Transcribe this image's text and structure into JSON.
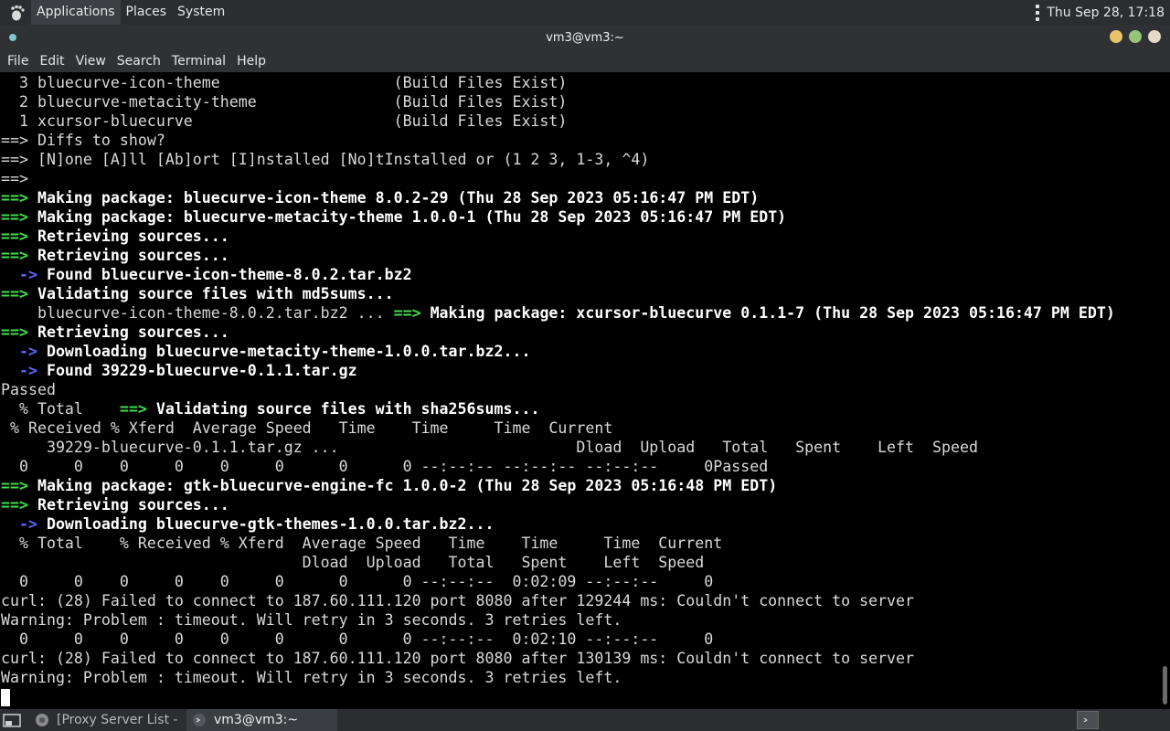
{
  "top_panel": {
    "menus": [
      "Applications",
      "Places",
      "System"
    ],
    "clock": "Thu Sep 28, 17:18"
  },
  "window": {
    "title": "vm3@vm3:~",
    "menu": [
      "File",
      "Edit",
      "View",
      "Search",
      "Terminal",
      "Help"
    ]
  },
  "terminal": {
    "lines": [
      [
        {
          "t": "  3 bluecurve-icon-theme                   (Build Files Exist)",
          "s": "n"
        }
      ],
      [
        {
          "t": "  2 bluecurve-metacity-theme               (Build Files Exist)",
          "s": "n"
        }
      ],
      [
        {
          "t": "  1 xcursor-bluecurve                      (Build Files Exist)",
          "s": "n"
        }
      ],
      [
        {
          "t": "==> Diffs to show?",
          "s": "n"
        }
      ],
      [
        {
          "t": "==> [N]one [A]ll [Ab]ort [I]nstalled [No]tInstalled or (1 2 3, 1-3, ^4)",
          "s": "n"
        }
      ],
      [
        {
          "t": "==> ",
          "s": "n"
        }
      ],
      [
        {
          "t": "==> ",
          "s": "g"
        },
        {
          "t": "Making package: bluecurve-icon-theme 8.0.2-29 (Thu 28 Sep 2023 05:16:47 PM EDT)",
          "s": "b"
        }
      ],
      [
        {
          "t": "==> ",
          "s": "g"
        },
        {
          "t": "Making package: bluecurve-metacity-theme 1.0.0-1 (Thu 28 Sep 2023 05:16:47 PM EDT)",
          "s": "b"
        }
      ],
      [
        {
          "t": "==> ",
          "s": "g"
        },
        {
          "t": "Retrieving sources...",
          "s": "b"
        }
      ],
      [
        {
          "t": "==> ",
          "s": "g"
        },
        {
          "t": "Retrieving sources...",
          "s": "b"
        }
      ],
      [
        {
          "t": "  -> ",
          "s": "u"
        },
        {
          "t": "Found bluecurve-icon-theme-8.0.2.tar.bz2",
          "s": "b"
        }
      ],
      [
        {
          "t": "==> ",
          "s": "g"
        },
        {
          "t": "Validating source files with md5sums...",
          "s": "b"
        }
      ],
      [
        {
          "t": "    bluecurve-icon-theme-8.0.2.tar.bz2 ... ",
          "s": "n"
        },
        {
          "t": "==> ",
          "s": "g"
        },
        {
          "t": "Making package: xcursor-bluecurve 0.1.1-7 (Thu 28 Sep 2023 05:16:47 PM EDT)",
          "s": "b"
        }
      ],
      [
        {
          "t": "==> ",
          "s": "g"
        },
        {
          "t": "Retrieving sources...",
          "s": "b"
        }
      ],
      [
        {
          "t": "  -> ",
          "s": "u"
        },
        {
          "t": "Downloading bluecurve-metacity-theme-1.0.0.tar.bz2...",
          "s": "b"
        }
      ],
      [
        {
          "t": "  -> ",
          "s": "u"
        },
        {
          "t": "Found 39229-bluecurve-0.1.1.tar.gz",
          "s": "b"
        }
      ],
      [
        {
          "t": "Passed",
          "s": "n"
        }
      ],
      [
        {
          "t": "  % Total    ",
          "s": "n"
        },
        {
          "t": "==> ",
          "s": "g"
        },
        {
          "t": "Validating source files with sha256sums...",
          "s": "b"
        }
      ],
      [
        {
          "t": " % Received % Xferd  Average Speed   Time    Time     Time  Current",
          "s": "n"
        }
      ],
      [
        {
          "t": "     39229-bluecurve-0.1.1.tar.gz ...                          Dload  Upload   Total   Spent    Left  Speed",
          "s": "n"
        }
      ],
      [
        {
          "t": "  0     0    0     0    0     0      0      0 --:--:-- --:--:-- --:--:--     0Passed",
          "s": "n"
        }
      ],
      [
        {
          "t": "==> ",
          "s": "g"
        },
        {
          "t": "Making package: gtk-bluecurve-engine-fc 1.0.0-2 (Thu 28 Sep 2023 05:16:48 PM EDT)",
          "s": "b"
        }
      ],
      [
        {
          "t": "==> ",
          "s": "g"
        },
        {
          "t": "Retrieving sources...",
          "s": "b"
        }
      ],
      [
        {
          "t": "  -> ",
          "s": "u"
        },
        {
          "t": "Downloading bluecurve-gtk-themes-1.0.0.tar.bz2...",
          "s": "b"
        }
      ],
      [
        {
          "t": "  % Total    % Received % Xferd  Average Speed   Time    Time     Time  Current",
          "s": "n"
        }
      ],
      [
        {
          "t": "                                 Dload  Upload   Total   Spent    Left  Speed",
          "s": "n"
        }
      ],
      [
        {
          "t": "  0     0    0     0    0     0      0      0 --:--:--  0:02:09 --:--:--     0",
          "s": "n"
        }
      ],
      [
        {
          "t": "curl: (28) Failed to connect to 187.60.111.120 port 8080 after 129244 ms: Couldn't connect to server",
          "s": "n"
        }
      ],
      [
        {
          "t": "Warning: Problem : timeout. Will retry in 3 seconds. 3 retries left.",
          "s": "n"
        }
      ],
      [
        {
          "t": "  0     0    0     0    0     0      0      0 --:--:--  0:02:10 --:--:--     0",
          "s": "n"
        }
      ],
      [
        {
          "t": "curl: (28) Failed to connect to 187.60.111.120 port 8080 after 130139 ms: Couldn't connect to server",
          "s": "n"
        }
      ],
      [
        {
          "t": "Warning: Problem : timeout. Will retry in 3 seconds. 3 retries left.",
          "s": "n"
        }
      ]
    ]
  },
  "taskbar": {
    "tasks": [
      {
        "label": "[Proxy Server List - j...",
        "icon": "browser-icon"
      },
      {
        "label": "vm3@vm3:~",
        "icon": "terminal-icon"
      }
    ]
  },
  "colors": {
    "arrow_green": "#3fe04a",
    "arrow_blue": "#5b67ff",
    "panel_bg": "#2b2d30"
  }
}
